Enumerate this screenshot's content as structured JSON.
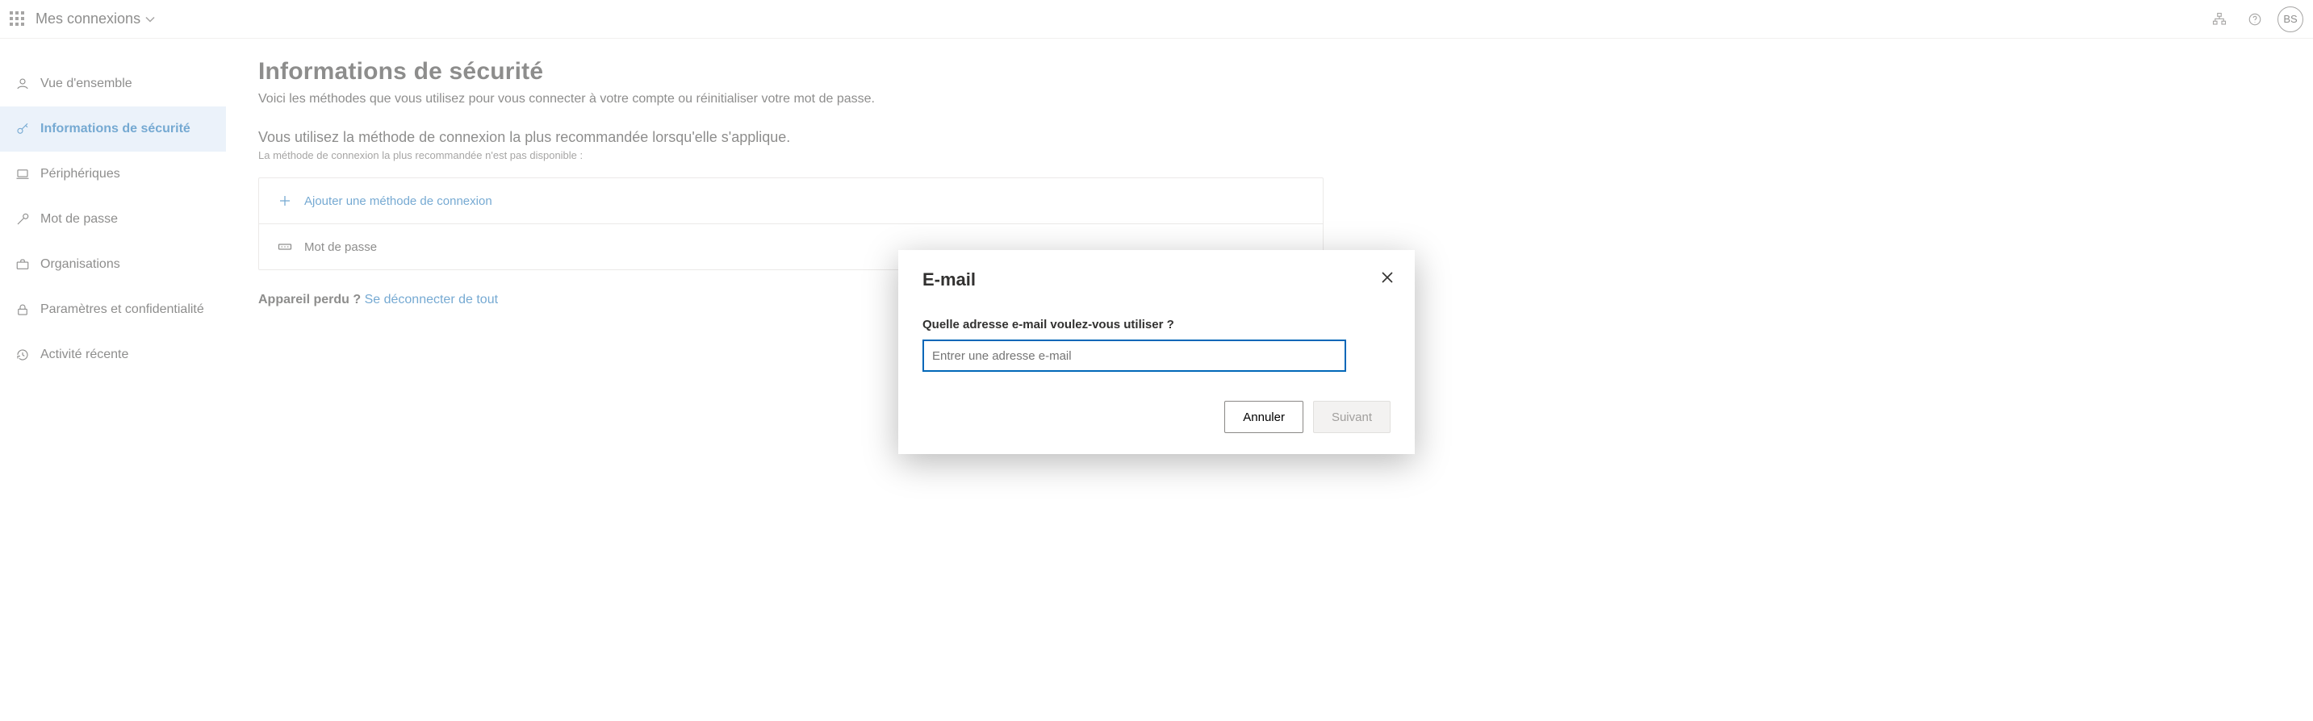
{
  "header": {
    "app_title": "Mes connexions",
    "avatar_initials": "BS"
  },
  "sidebar": {
    "items": [
      {
        "label": "Vue d'ensemble"
      },
      {
        "label": "Informations de sécurité"
      },
      {
        "label": "Périphériques"
      },
      {
        "label": "Mot de passe"
      },
      {
        "label": "Organisations"
      },
      {
        "label": "Paramètres et confidentialité"
      },
      {
        "label": "Activité récente"
      }
    ]
  },
  "main": {
    "title": "Informations de sécurité",
    "subtitle": "Voici les méthodes que vous utilisez pour vous connecter à votre compte ou réinitialiser votre mot de passe.",
    "method_heading": "Vous utilisez la méthode de connexion la plus recommandée lorsqu'elle s'applique.",
    "method_subnote": "La méthode de connexion la plus recommandée n'est pas disponible :",
    "add_label": "Ajouter une méthode de connexion",
    "methods": [
      {
        "label": "Mot de passe"
      }
    ],
    "lost_device_q": "Appareil perdu ?",
    "lost_device_link": "Se déconnecter de tout"
  },
  "modal": {
    "title": "E-mail",
    "label": "Quelle adresse e-mail voulez-vous utiliser ?",
    "placeholder": "Entrer une adresse e-mail",
    "value": "",
    "cancel": "Annuler",
    "next": "Suivant"
  }
}
